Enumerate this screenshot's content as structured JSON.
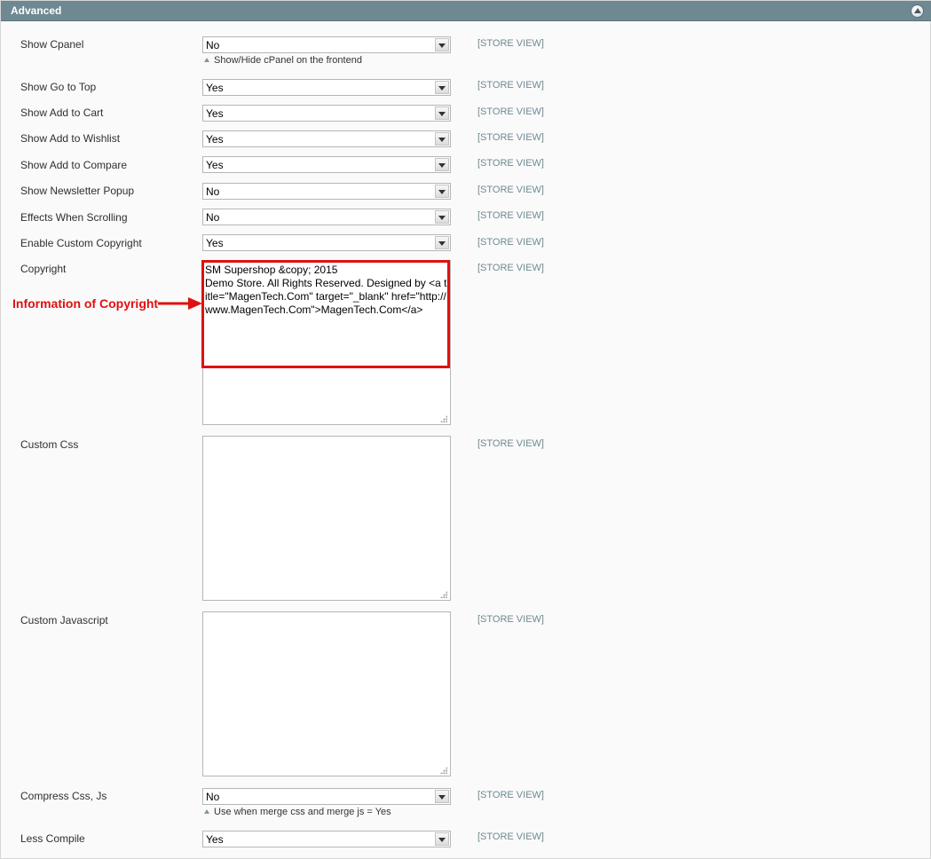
{
  "section": {
    "title": "Advanced",
    "collapse_icon": "collapse-up-icon"
  },
  "scope_label": "[STORE VIEW]",
  "fields": {
    "show_cpanel": {
      "label": "Show Cpanel",
      "value": "No",
      "note": "Show/Hide cPanel on the frontend"
    },
    "show_go_to_top": {
      "label": "Show Go to Top",
      "value": "Yes"
    },
    "show_add_to_cart": {
      "label": "Show Add to Cart",
      "value": "Yes"
    },
    "show_add_to_wishlist": {
      "label": "Show Add to Wishlist",
      "value": "Yes"
    },
    "show_add_to_compare": {
      "label": "Show Add to Compare",
      "value": "Yes"
    },
    "show_newsletter_popup": {
      "label": "Show Newsletter Popup",
      "value": "No"
    },
    "effects_when_scrolling": {
      "label": "Effects When Scrolling",
      "value": "No"
    },
    "enable_custom_copyright": {
      "label": "Enable Custom Copyright",
      "value": "Yes"
    },
    "copyright": {
      "label": "Copyright",
      "value": "SM Supershop &copy; 2015\nDemo Store. All Rights Reserved. Designed by <a title=\"MagenTech.Com\" target=\"_blank\" href=\"http://www.MagenTech.Com\">MagenTech.Com</a>"
    },
    "custom_css": {
      "label": "Custom Css",
      "value": ""
    },
    "custom_javascript": {
      "label": "Custom Javascript",
      "value": ""
    },
    "compress_css_js": {
      "label": "Compress Css, Js",
      "value": "No",
      "note": "Use when merge css and merge js = Yes"
    },
    "less_compile": {
      "label": "Less Compile",
      "value": "Yes"
    }
  },
  "annotation": {
    "text": "Information of Copyright",
    "color": "#e01010"
  }
}
